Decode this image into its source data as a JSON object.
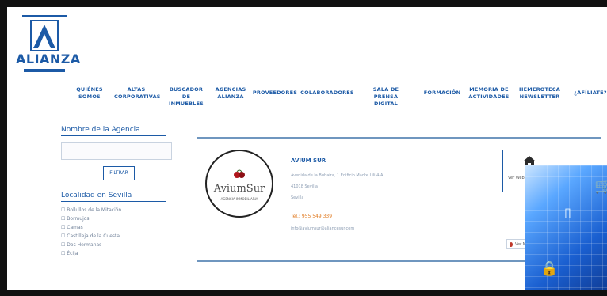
{
  "brand": {
    "logo_text": "ALIANZA"
  },
  "nav": {
    "items": [
      {
        "label": "QUIÉNES\nSOMOS"
      },
      {
        "label": "ALTAS\nCORPORATIVAS"
      },
      {
        "label": "BUSCADOR DE\nINMUEBLES"
      },
      {
        "label": "AGENCIAS\nALIANZA"
      },
      {
        "label": "PROVEEDORES"
      },
      {
        "label": "COLABORADORES"
      },
      {
        "label": "SALA DE PRENSA\nDIGITAL"
      },
      {
        "label": "FORMACIÓN"
      },
      {
        "label": "MEMORIA DE\nACTIVIDADES"
      },
      {
        "label": "HEMEROTECA\nNEWSLETTER"
      },
      {
        "label": "¿AFÍLIATE?"
      }
    ]
  },
  "sidebar": {
    "agency_name_label": "Nombre de la Agencia",
    "agency_name_value": "",
    "filter_button": "FILTRAR",
    "locality_label": "Localidad en Sevilla",
    "localities": [
      "Bollullos de la Mitación",
      "Bormujos",
      "Camas",
      "Castilleja de la Cuesta",
      "Dos Hermanas",
      "Écija"
    ]
  },
  "agency": {
    "logo_name": "AviumSur",
    "logo_tagline": "AGENCIA INMOBILIARIA",
    "name": "AVIUM SUR",
    "address": "Avenida de la Buhaira, 1 Edificio Madre Lili 4-A",
    "postal": "41018 Sevilla",
    "city": "Sevilla",
    "phone_label": "Tel.:",
    "phone": "955 549 339",
    "email": "info@aviumsur@aliancesur.com",
    "web_label": "Ver Web",
    "map_label": "Ver Mapa"
  },
  "colors": {
    "accent": "#1c5aa6",
    "phone": "#e07a20",
    "rule": "#6f96bf"
  },
  "icons": [
    "house-icon",
    "map-pin-icon",
    "cart-icon",
    "lock-icon",
    "tablet-icon"
  ]
}
